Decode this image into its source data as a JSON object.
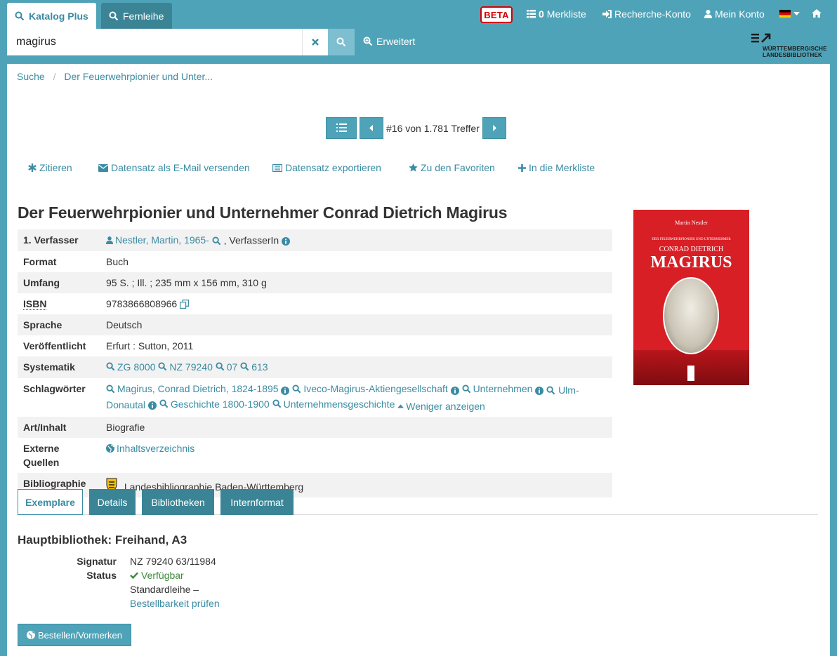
{
  "header": {
    "tab_catalog": "Katalog Plus",
    "tab_ill": "Fernleihe",
    "beta": "BETA",
    "watchlist_count": "0",
    "watchlist_label": "Merkliste",
    "research_account": "Recherche-Konto",
    "my_account": "Mein Konto",
    "language_flag": "DE",
    "logo_line1": "WÜRTTEMBERGISCHE",
    "logo_line2": "LANDESBIBLIOTHEK"
  },
  "search": {
    "query": "magirus",
    "advanced": "Erweitert"
  },
  "breadcrumb": {
    "home": "Suche",
    "current": "Der Feuerwehrpionier und Unter..."
  },
  "pager": {
    "position": "#16 von 1.781 Treffer"
  },
  "actions": {
    "cite": "Zitieren",
    "email": "Datensatz als E-Mail versenden",
    "export": "Datensatz exportieren",
    "favorites": "Zu den Favoriten",
    "watchlist": "In die Merkliste"
  },
  "record": {
    "title": "Der Feuerwehrpionier und Unternehmer Conrad Dietrich Magirus",
    "author_label": "1. Verfasser",
    "author": "Nestler, Martin, 1965-",
    "author_role": ", VerfasserIn",
    "format_label": "Format",
    "format": "Buch",
    "extent_label": "Umfang",
    "extent": "95 S. ; Ill. ; 235 mm x 156 mm, 310 g",
    "isbn_label": "ISBN",
    "isbn": "9783866808966",
    "language_label": "Sprache",
    "language": "Deutsch",
    "published_label": "Veröffentlicht",
    "published": "Erfurt : Sutton, 2011",
    "classification_label": "Systematik",
    "classification": [
      "ZG 8000",
      "NZ 79240",
      "07",
      "613"
    ],
    "subjects_label": "Schlagwörter",
    "subjects": [
      "Magirus, Conrad Dietrich, 1824-1895",
      "Iveco-Magirus-Aktiengesellschaft",
      "Unternehmen",
      "Ulm-Donautal",
      "Geschichte 1800-1900",
      "Unternehmensgeschichte"
    ],
    "show_less": "Weniger anzeigen",
    "content_label": "Art/Inhalt",
    "content": "Biografie",
    "external_label_1": "Externe",
    "external_label_2": "Quellen",
    "external": "Inhaltsverzeichnis",
    "bibliography_label": "Bibliographie",
    "bibliography": "Landesbibliographie Baden-Württemberg"
  },
  "cover": {
    "author": "Martin Nestler",
    "subtitle": "DER FEUERWEHRPIONIER UND UNTERNEHMER",
    "name": "CONRAD DIETRICH",
    "surname": "MAGIRUS"
  },
  "tabs": [
    "Exemplare",
    "Details",
    "Bibliotheken",
    "Internformat"
  ],
  "holding": {
    "location": "Hauptbibliothek: Freihand, A3",
    "signature_label": "Signatur",
    "signature": "NZ 79240 63/11984",
    "status_label": "Status",
    "status": "Verfügbar",
    "loan_type": "Standardleihe –",
    "check_link": "Bestellbarkeit prüfen",
    "order_button": "Bestellen/Vormerken"
  },
  "colors": {
    "brand": "#4fa3b8",
    "link": "#3a8ca3",
    "beta": "#d40000",
    "available": "#3d8a3d"
  }
}
